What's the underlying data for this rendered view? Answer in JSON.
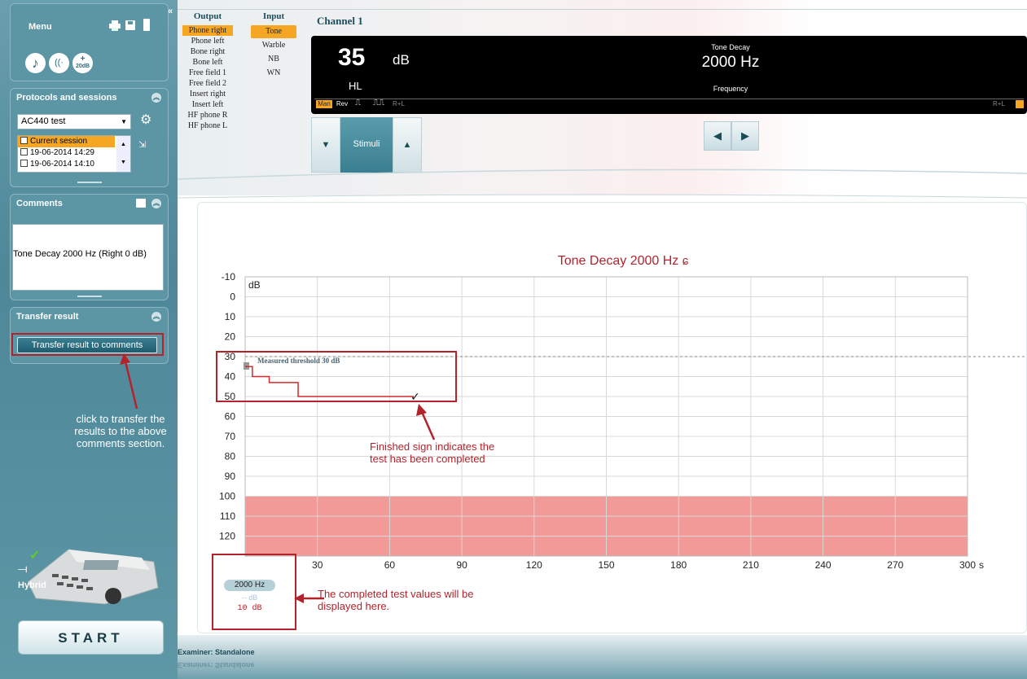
{
  "sidebar": {
    "menu_label": "Menu",
    "protocols": {
      "title": "Protocols and sessions",
      "selected_protocol": "AC440 test",
      "sessions": [
        "Current session",
        "19-06-2014 14:29",
        "19-06-2014 14:10"
      ]
    },
    "comments": {
      "title": "Comments",
      "text": "Tone Decay 2000 Hz (Right 0 dB)"
    },
    "transfer": {
      "title": "Transfer result",
      "button_label": "Transfer result to comments"
    },
    "annotation": "click to transfer the results to the above comments section.",
    "hybrid_label": "Hybrid",
    "start_label": "START",
    "icons": {
      "plus_label": "+",
      "db_label": "20dB"
    }
  },
  "output": {
    "header": "Output",
    "items": [
      "Phone right",
      "Phone left",
      "Bone right",
      "Bone left",
      "Free field 1",
      "Free field 2",
      "Insert right",
      "Insert left",
      "HF phone R",
      "HF phone L"
    ],
    "selected": "Phone right"
  },
  "input": {
    "header": "Input",
    "items": [
      "Tone",
      "Warble",
      "NB",
      "WN"
    ],
    "selected": "Tone"
  },
  "channel": {
    "title": "Channel 1",
    "level_value": "35",
    "level_unit": "dB",
    "level_scale": "HL",
    "test_name": "Tone Decay",
    "frequency_value": "2000 Hz",
    "frequency_label": "Frequency",
    "mode_buttons": [
      "Man",
      "Rev",
      "R+L"
    ],
    "right_mode": "R+L",
    "stimuli_label": "Stimuli"
  },
  "chart_data": {
    "type": "line",
    "title": "Tone Decay 2000 Hz",
    "ylabel": "dB",
    "xlabel": "s",
    "y_ticks": [
      -10,
      0,
      10,
      20,
      30,
      40,
      50,
      60,
      70,
      80,
      90,
      100,
      110,
      120
    ],
    "x_ticks": [
      30,
      60,
      90,
      120,
      150,
      180,
      210,
      240,
      270,
      300
    ],
    "xlim": [
      0,
      300
    ],
    "ylim": [
      -10,
      130
    ],
    "y_inverted": true,
    "threshold_label": "Measured threshold 30 dB",
    "threshold_db": 30,
    "trace": [
      [
        0,
        35
      ],
      [
        3,
        35
      ],
      [
        3,
        40
      ],
      [
        10,
        40
      ],
      [
        10,
        43
      ],
      [
        22,
        43
      ],
      [
        22,
        50
      ],
      [
        70,
        50
      ]
    ],
    "finish_point": [
      70,
      50
    ],
    "shaded_region_db": [
      100,
      130
    ],
    "colors": {
      "trace": "#d42a2a",
      "shade": "#f29a98",
      "title": "#b2232c"
    }
  },
  "result": {
    "freq": "2000 Hz",
    "placeholder": "-- dB",
    "value": "10 dB"
  },
  "annotations": {
    "finished": "Finished sign indicates the test has been completed",
    "values": "The completed test values will be displayed here."
  },
  "footer": {
    "examiner": "Examiner: Standalone"
  }
}
